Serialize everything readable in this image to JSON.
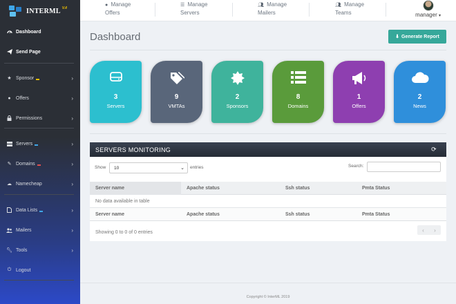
{
  "brand": {
    "name": "INTERML",
    "version": "V.4"
  },
  "sidebar": {
    "items": [
      {
        "label": "Dashboard",
        "icon": "dashboard-icon"
      },
      {
        "label": "Send Page",
        "icon": "paper-plane-icon"
      },
      {
        "label": "Sponsor",
        "icon": "star-icon",
        "mark": "#f0c000"
      },
      {
        "label": "Offers",
        "icon": "circle-icon"
      },
      {
        "label": "Permissions",
        "icon": "lock-icon"
      },
      {
        "label": "Servers",
        "icon": "server-icon",
        "mark": "#3fa6e8"
      },
      {
        "label": "Domains",
        "icon": "edit-icon",
        "mark": "#e05050"
      },
      {
        "label": "Namecheap",
        "icon": "cloud-icon"
      },
      {
        "label": "Data Lists",
        "icon": "file-icon",
        "mark": "#3fa6e8"
      },
      {
        "label": "Mailers",
        "icon": "users-icon"
      },
      {
        "label": "Tools",
        "icon": "wrench-icon"
      },
      {
        "label": "Logout",
        "icon": "power-icon"
      }
    ]
  },
  "topnav": {
    "items": [
      {
        "line1": "Manage",
        "line2": "Offers",
        "icon": "circle-icon"
      },
      {
        "line1": "Manage",
        "line2": "Servers",
        "icon": "list-icon"
      },
      {
        "line1": "Manage",
        "line2": "Mailers",
        "icon": "users-icon"
      },
      {
        "line1": "Manage",
        "line2": "Teams",
        "icon": "users-icon"
      }
    ],
    "user": "manager"
  },
  "page": {
    "title": "Dashboard",
    "generate_label": "Generate Report"
  },
  "tiles": [
    {
      "value": "3",
      "label": "Servers",
      "color": "#2cbfcf",
      "icon": "hdd-icon"
    },
    {
      "value": "9",
      "label": "VMTAs",
      "color": "#59667a",
      "icon": "tags-icon"
    },
    {
      "value": "2",
      "label": "Sponsors",
      "color": "#3fb39c",
      "icon": "certificate-icon"
    },
    {
      "value": "8",
      "label": "Domains",
      "color": "#5a9b3b",
      "icon": "list-icon"
    },
    {
      "value": "1",
      "label": "Offers",
      "color": "#8e3fb0",
      "icon": "bullhorn-icon"
    },
    {
      "value": "2",
      "label": "News",
      "color": "#2f8fdb",
      "icon": "cloud-icon"
    }
  ],
  "monitoring": {
    "title": "SERVERS MONITORING",
    "show_label": "Show",
    "show_value": "10",
    "entries_label": "entries",
    "search_label": "Search:",
    "columns": [
      "Server name",
      "Apache status",
      "Ssh status",
      "Pmta Status"
    ],
    "empty_text": "No data available in table",
    "info": "Showing 0 to 0 of 0 entries"
  },
  "footer": {
    "copyright": "Copyright © InterML 2019"
  }
}
